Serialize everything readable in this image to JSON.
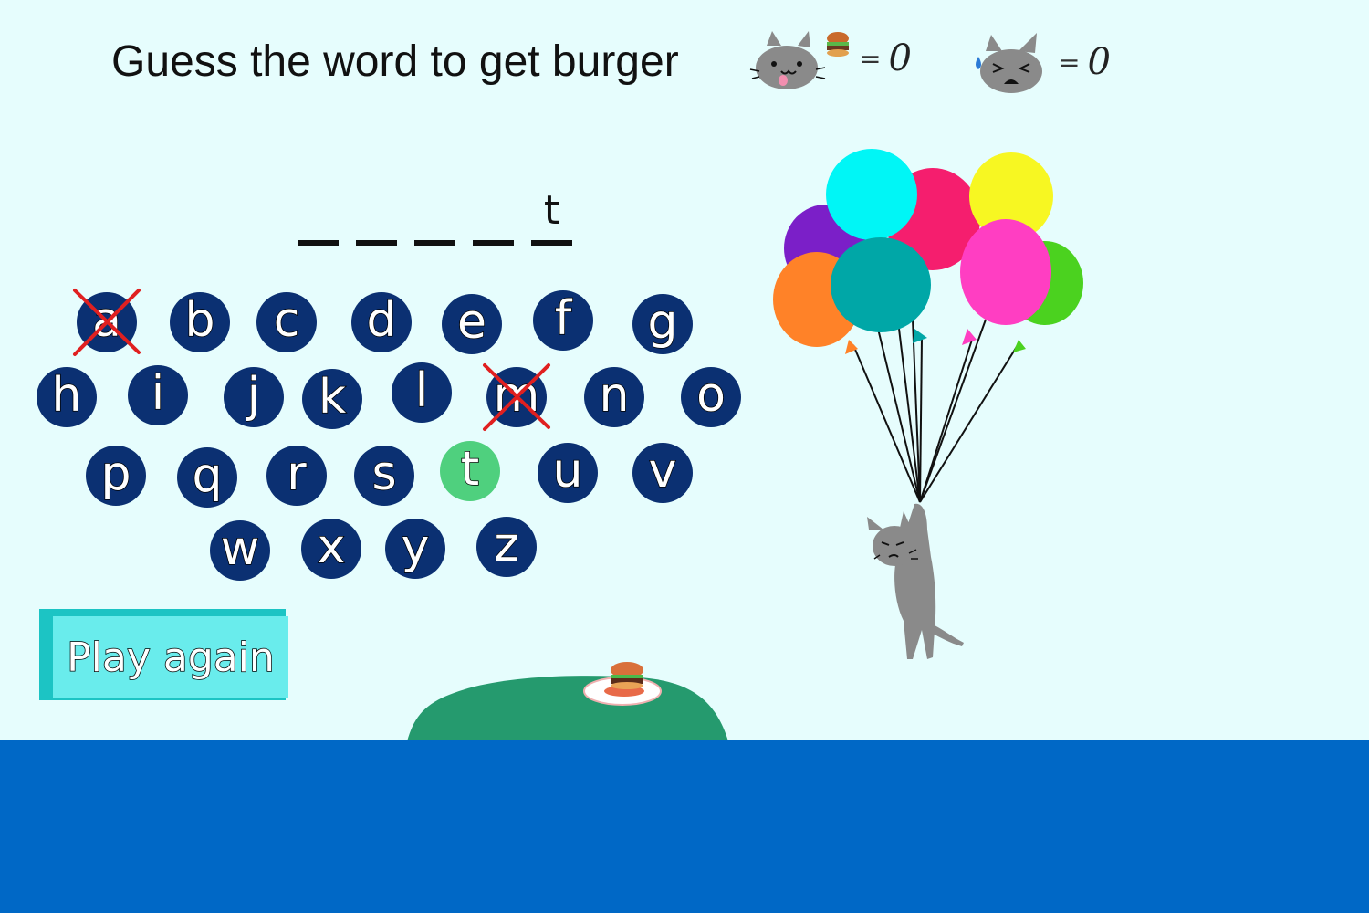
{
  "title": "Guess the word to get burger",
  "score_fed": {
    "equals": "=",
    "value": "0"
  },
  "score_sad": {
    "equals": "=",
    "value": "0"
  },
  "word": {
    "slots": [
      "",
      "",
      "",
      "",
      "t"
    ]
  },
  "keyboard": {
    "rows": [
      [
        "a",
        "b",
        "c",
        "d",
        "e",
        "f",
        "g"
      ],
      [
        "h",
        "i",
        "j",
        "k",
        "l",
        "m",
        "n",
        "o"
      ],
      [
        "p",
        "q",
        "r",
        "s",
        "t",
        "u",
        "v"
      ],
      [
        "w",
        "x",
        "y",
        "z"
      ]
    ],
    "wrong": [
      "a",
      "m"
    ],
    "correct": [
      "t"
    ]
  },
  "play_again_label": "Play again",
  "colors": {
    "background": "#e6fdfd",
    "key": "#0b3072",
    "key_correct": "#4fd07e",
    "cross": "#e02020",
    "sea": "#0068c6",
    "island": "#259a6e",
    "button": "#69ecec",
    "button_shadow": "#1cc4c4"
  }
}
